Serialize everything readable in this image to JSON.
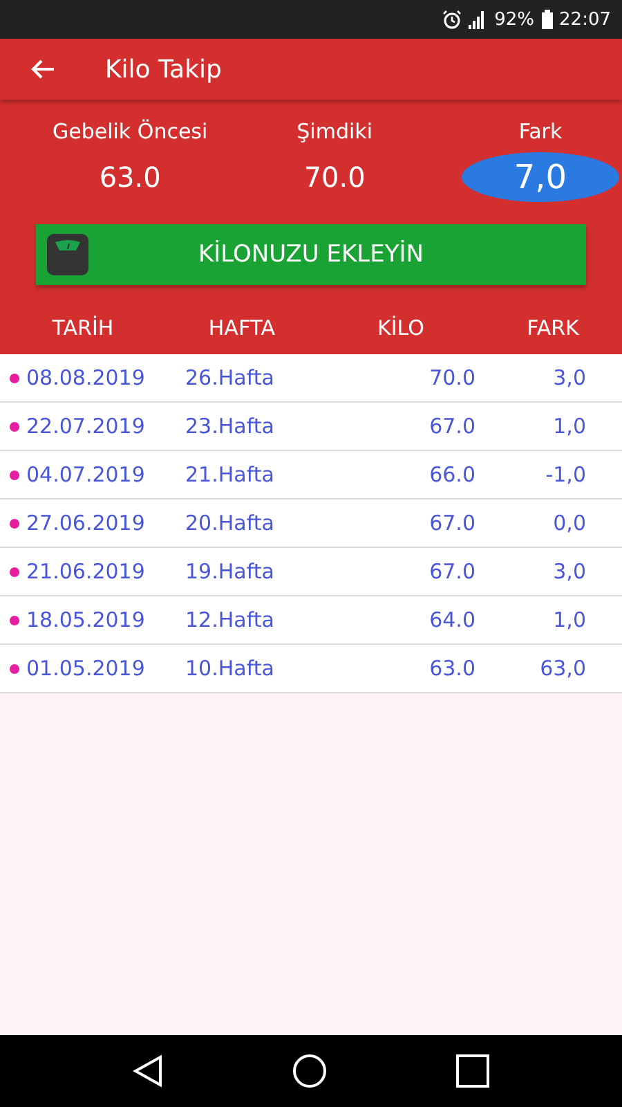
{
  "status_bar": {
    "battery": "92%",
    "time": "22:07"
  },
  "app_bar": {
    "title": "Kilo Takip"
  },
  "summary": [
    {
      "label": "Gebelik Öncesi",
      "value": "63.0",
      "highlighted": false
    },
    {
      "label": "Şimdiki",
      "value": "70.0",
      "highlighted": false
    },
    {
      "label": "Fark",
      "value": "7,0",
      "highlighted": true
    }
  ],
  "add_button": {
    "label": "KİLONUZU EKLEYİN"
  },
  "table": {
    "columns": [
      "TARİH",
      "HAFTA",
      "KİLO",
      "FARK"
    ],
    "rows": [
      {
        "date": "08.08.2019",
        "week": "26.Hafta",
        "weight": "70.0",
        "diff": "3,0"
      },
      {
        "date": "22.07.2019",
        "week": "23.Hafta",
        "weight": "67.0",
        "diff": "1,0"
      },
      {
        "date": "04.07.2019",
        "week": "21.Hafta",
        "weight": "66.0",
        "diff": "-1,0"
      },
      {
        "date": "27.06.2019",
        "week": "20.Hafta",
        "weight": "67.0",
        "diff": "0,0"
      },
      {
        "date": "21.06.2019",
        "week": "19.Hafta",
        "weight": "67.0",
        "diff": "3,0"
      },
      {
        "date": "18.05.2019",
        "week": "12.Hafta",
        "weight": "64.0",
        "diff": "1,0"
      },
      {
        "date": "01.05.2019",
        "week": "10.Hafta",
        "weight": "63.0",
        "diff": "63,0"
      }
    ]
  }
}
